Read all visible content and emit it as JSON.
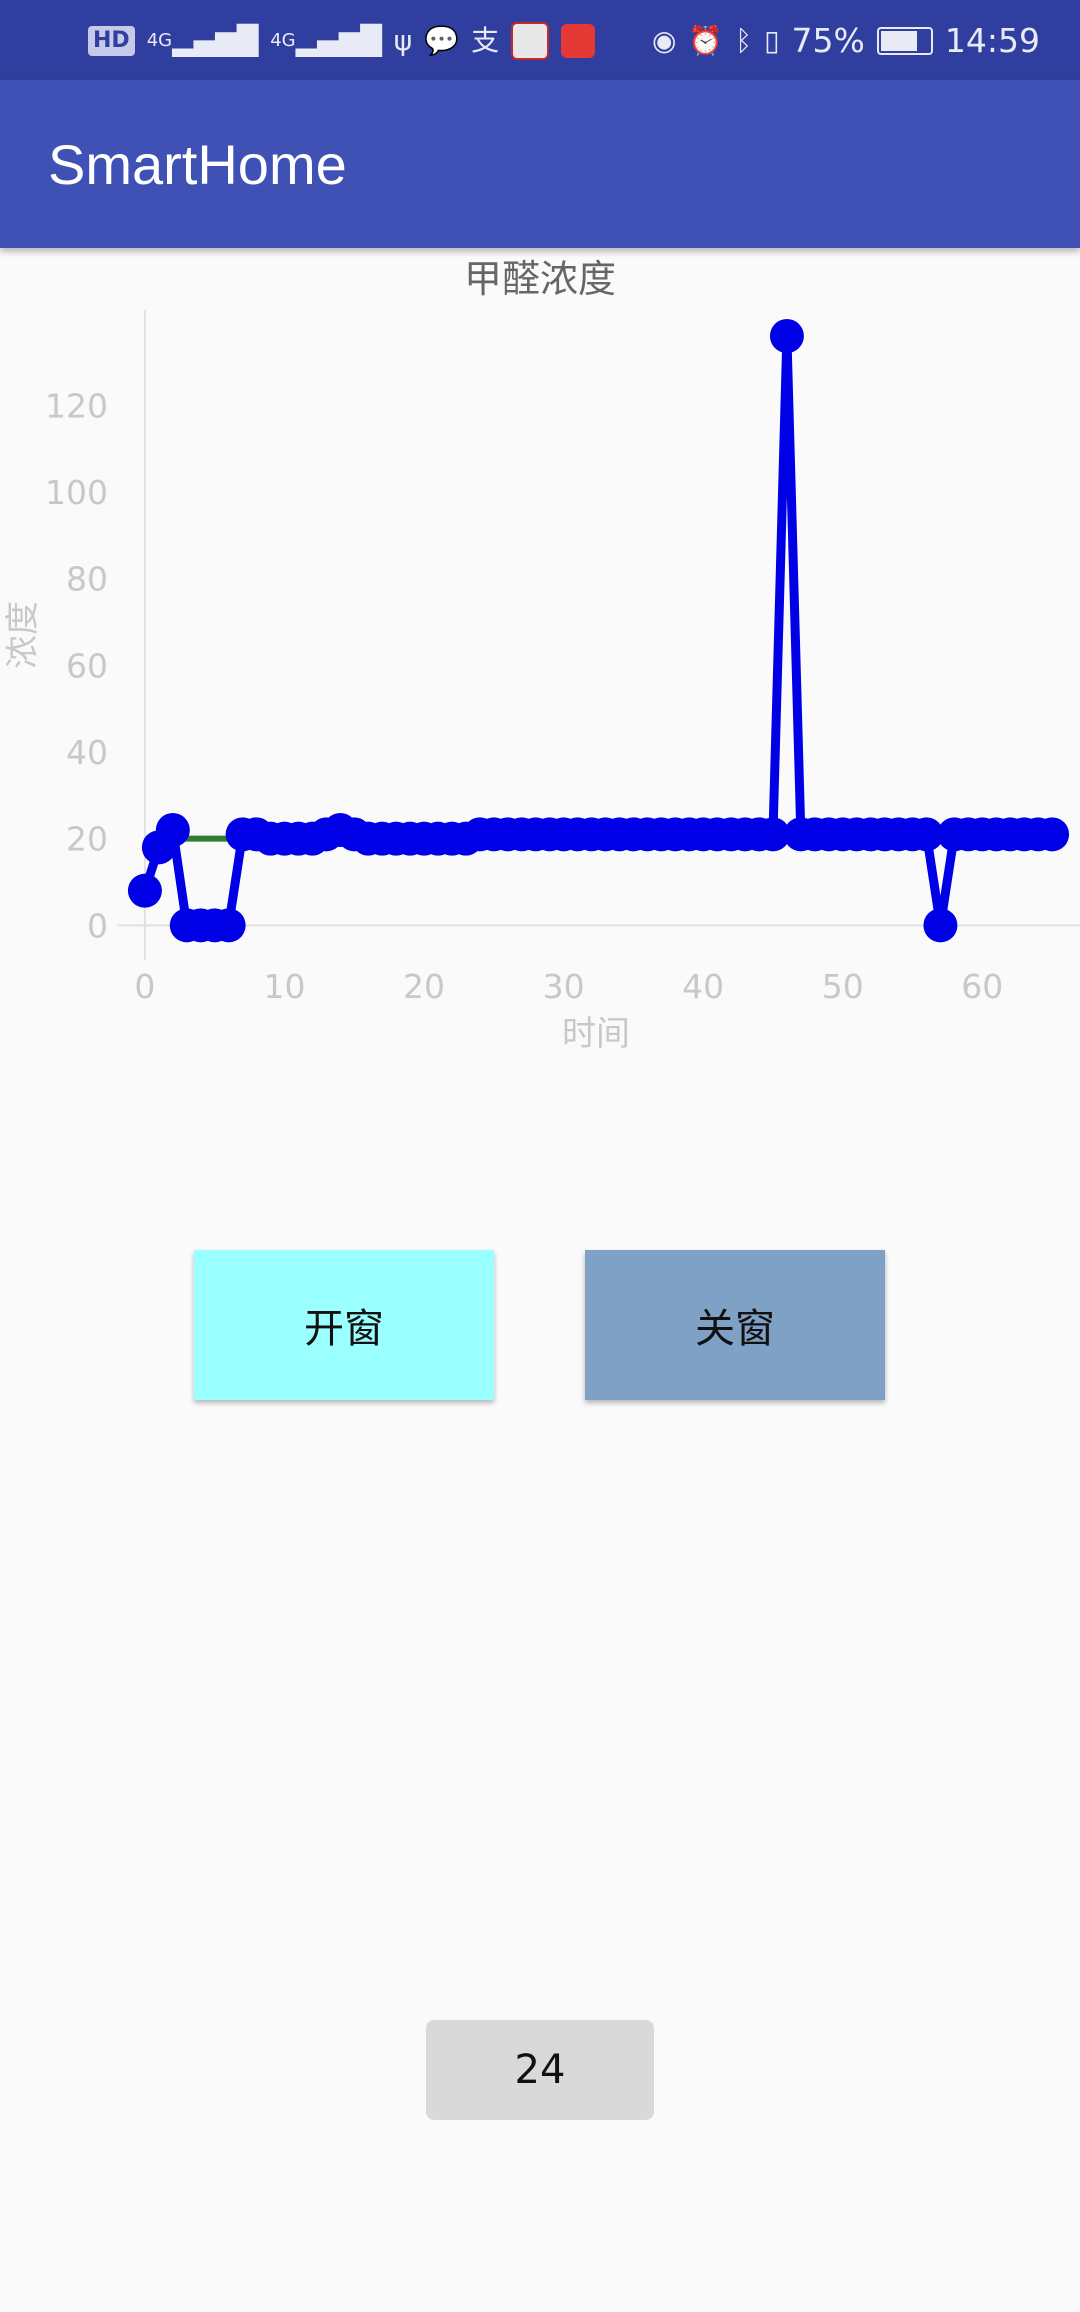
{
  "status_bar": {
    "left_icons": [
      "hd-icon",
      "signal-4g-1-icon",
      "signal-4g-2-icon",
      "usb-icon",
      "message-icon",
      "alipay-icon",
      "zhihu-app-icon",
      "red-app-icon"
    ],
    "hd_label": "HD",
    "sig1": "4G",
    "sig2": "4G",
    "battery": "75%",
    "time": "14:59",
    "right_icons": [
      "eye-icon",
      "alarm-icon",
      "bluetooth-icon",
      "vibrate-icon",
      "battery-icon"
    ]
  },
  "app_bar": {
    "title": "SmartHome"
  },
  "chart_data": {
    "type": "line",
    "title": "甲醛浓度",
    "xlabel": "时间",
    "ylabel": "浓度",
    "xlim": [
      -2,
      67
    ],
    "ylim": [
      -8,
      142
    ],
    "xticks": [
      0,
      10,
      20,
      30,
      40,
      50,
      60
    ],
    "yticks": [
      0,
      20,
      40,
      60,
      80,
      100,
      120
    ],
    "grid": false,
    "series": [
      {
        "color": "#0000e6",
        "x": [
          0,
          1,
          2,
          3,
          4,
          5,
          6,
          7,
          8,
          9,
          10,
          11,
          12,
          13,
          14,
          15,
          16,
          17,
          18,
          19,
          20,
          21,
          22,
          23,
          24,
          25,
          26,
          27,
          28,
          29,
          30,
          31,
          32,
          33,
          34,
          35,
          36,
          37,
          38,
          39,
          40,
          41,
          42,
          43,
          44,
          45,
          46,
          47,
          48,
          49,
          50,
          51,
          52,
          53,
          54,
          55,
          56,
          57,
          58,
          59,
          60,
          61,
          62,
          63,
          64,
          65
        ],
        "y": [
          8,
          18,
          22,
          0,
          0,
          0,
          0,
          21,
          21,
          20,
          20,
          20,
          20,
          21,
          22,
          21,
          20,
          20,
          20,
          20,
          20,
          20,
          20,
          20,
          21,
          21,
          21,
          21,
          21,
          21,
          21,
          21,
          21,
          21,
          21,
          21,
          21,
          21,
          21,
          21,
          21,
          21,
          21,
          21,
          21,
          21,
          136,
          21,
          21,
          21,
          21,
          21,
          21,
          21,
          21,
          21,
          21,
          0,
          21,
          21,
          21,
          21,
          21,
          21,
          21,
          21
        ]
      },
      {
        "color": "#2e7d32",
        "x": [
          2,
          65
        ],
        "y": [
          20,
          20
        ]
      }
    ]
  },
  "buttons": {
    "open_window": "开窗",
    "close_window": "关窗"
  },
  "value_display": "24"
}
